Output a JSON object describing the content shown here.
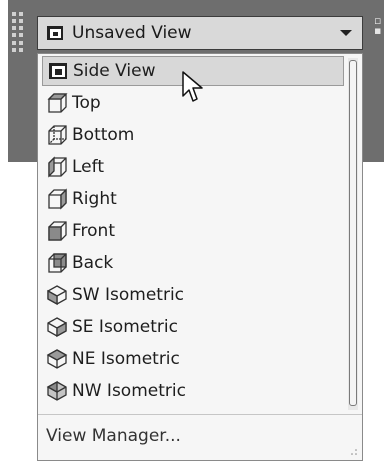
{
  "combo": {
    "selected_label": "Unsaved View",
    "icon": "view-icon"
  },
  "menu": {
    "items": [
      {
        "label": "Side View",
        "icon": "side-view-icon",
        "selected": true
      },
      {
        "label": "Top",
        "icon": "cube-top-icon"
      },
      {
        "label": "Bottom",
        "icon": "cube-bottom-icon"
      },
      {
        "label": "Left",
        "icon": "cube-left-icon"
      },
      {
        "label": "Right",
        "icon": "cube-right-icon"
      },
      {
        "label": "Front",
        "icon": "cube-front-icon"
      },
      {
        "label": "Back",
        "icon": "cube-back-icon"
      },
      {
        "label": "SW Isometric",
        "icon": "iso-sw-icon"
      },
      {
        "label": "SE Isometric",
        "icon": "iso-se-icon"
      },
      {
        "label": "NE Isometric",
        "icon": "iso-ne-icon"
      },
      {
        "label": "NW Isometric",
        "icon": "iso-nw-icon"
      }
    ],
    "footer_label": "View Manager..."
  },
  "colors": {
    "toolbar": "#6e6e6e",
    "selected_bg": "#d8d8d8",
    "menu_bg": "#f6f6f6"
  }
}
